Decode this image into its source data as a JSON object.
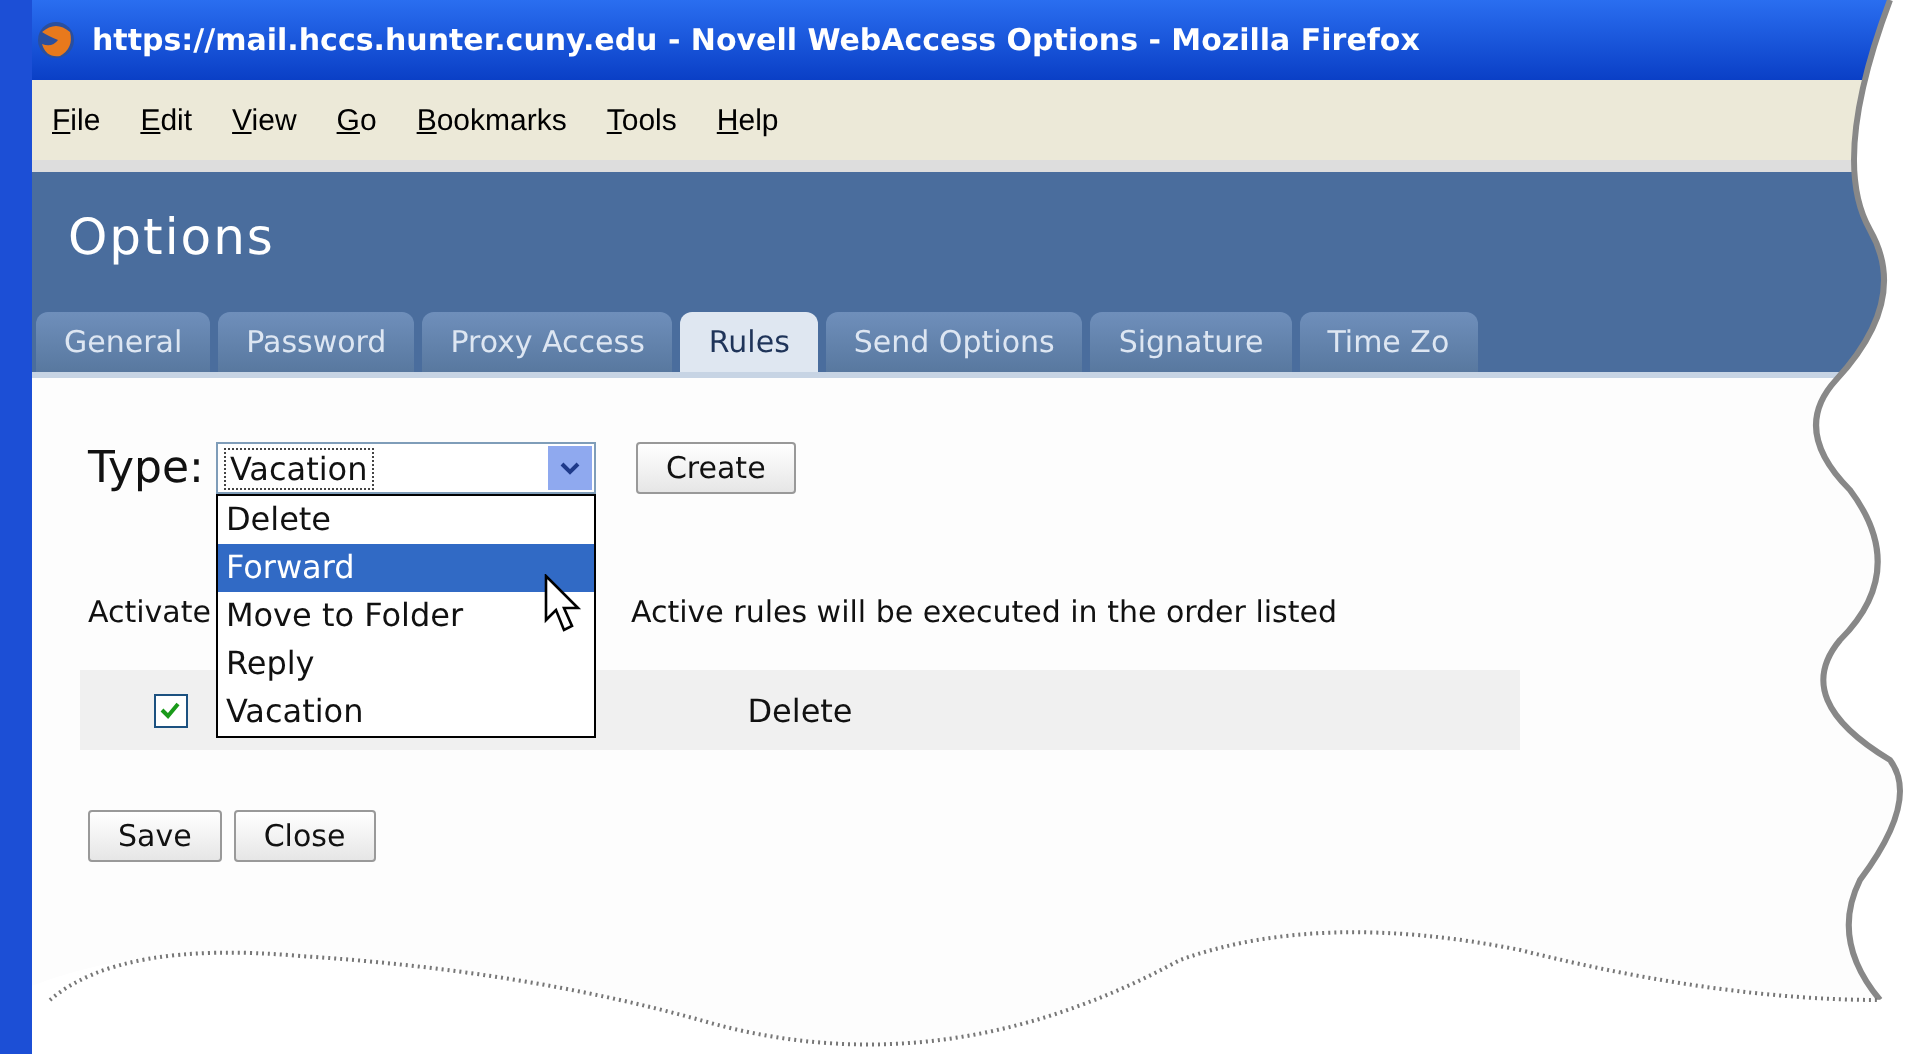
{
  "window": {
    "title": "https://mail.hccs.hunter.cuny.edu - Novell WebAccess Options - Mozilla Firefox"
  },
  "menu": [
    "File",
    "Edit",
    "View",
    "Go",
    "Bookmarks",
    "Tools",
    "Help"
  ],
  "header": {
    "title": "Options"
  },
  "tabs": [
    {
      "label": "General",
      "selected": false
    },
    {
      "label": "Password",
      "selected": false
    },
    {
      "label": "Proxy Access",
      "selected": false
    },
    {
      "label": "Rules",
      "selected": true
    },
    {
      "label": "Send Options",
      "selected": false
    },
    {
      "label": "Signature",
      "selected": false
    },
    {
      "label": "Time Zo",
      "selected": false
    }
  ],
  "type_field": {
    "label": "Type:",
    "value": "Vacation",
    "expanded": true,
    "options": [
      {
        "label": "Delete",
        "highlighted": false
      },
      {
        "label": "Forward",
        "highlighted": true
      },
      {
        "label": "Move to Folder",
        "highlighted": false
      },
      {
        "label": "Reply",
        "highlighted": false
      },
      {
        "label": "Vacation",
        "highlighted": false
      }
    ]
  },
  "create_button": "Create",
  "rules_header": {
    "activate": "Activate",
    "note": "Active rules will be executed in the order listed"
  },
  "rules": [
    {
      "checked": true,
      "name": "Delete"
    }
  ],
  "buttons": [
    "Save",
    "Close"
  ]
}
